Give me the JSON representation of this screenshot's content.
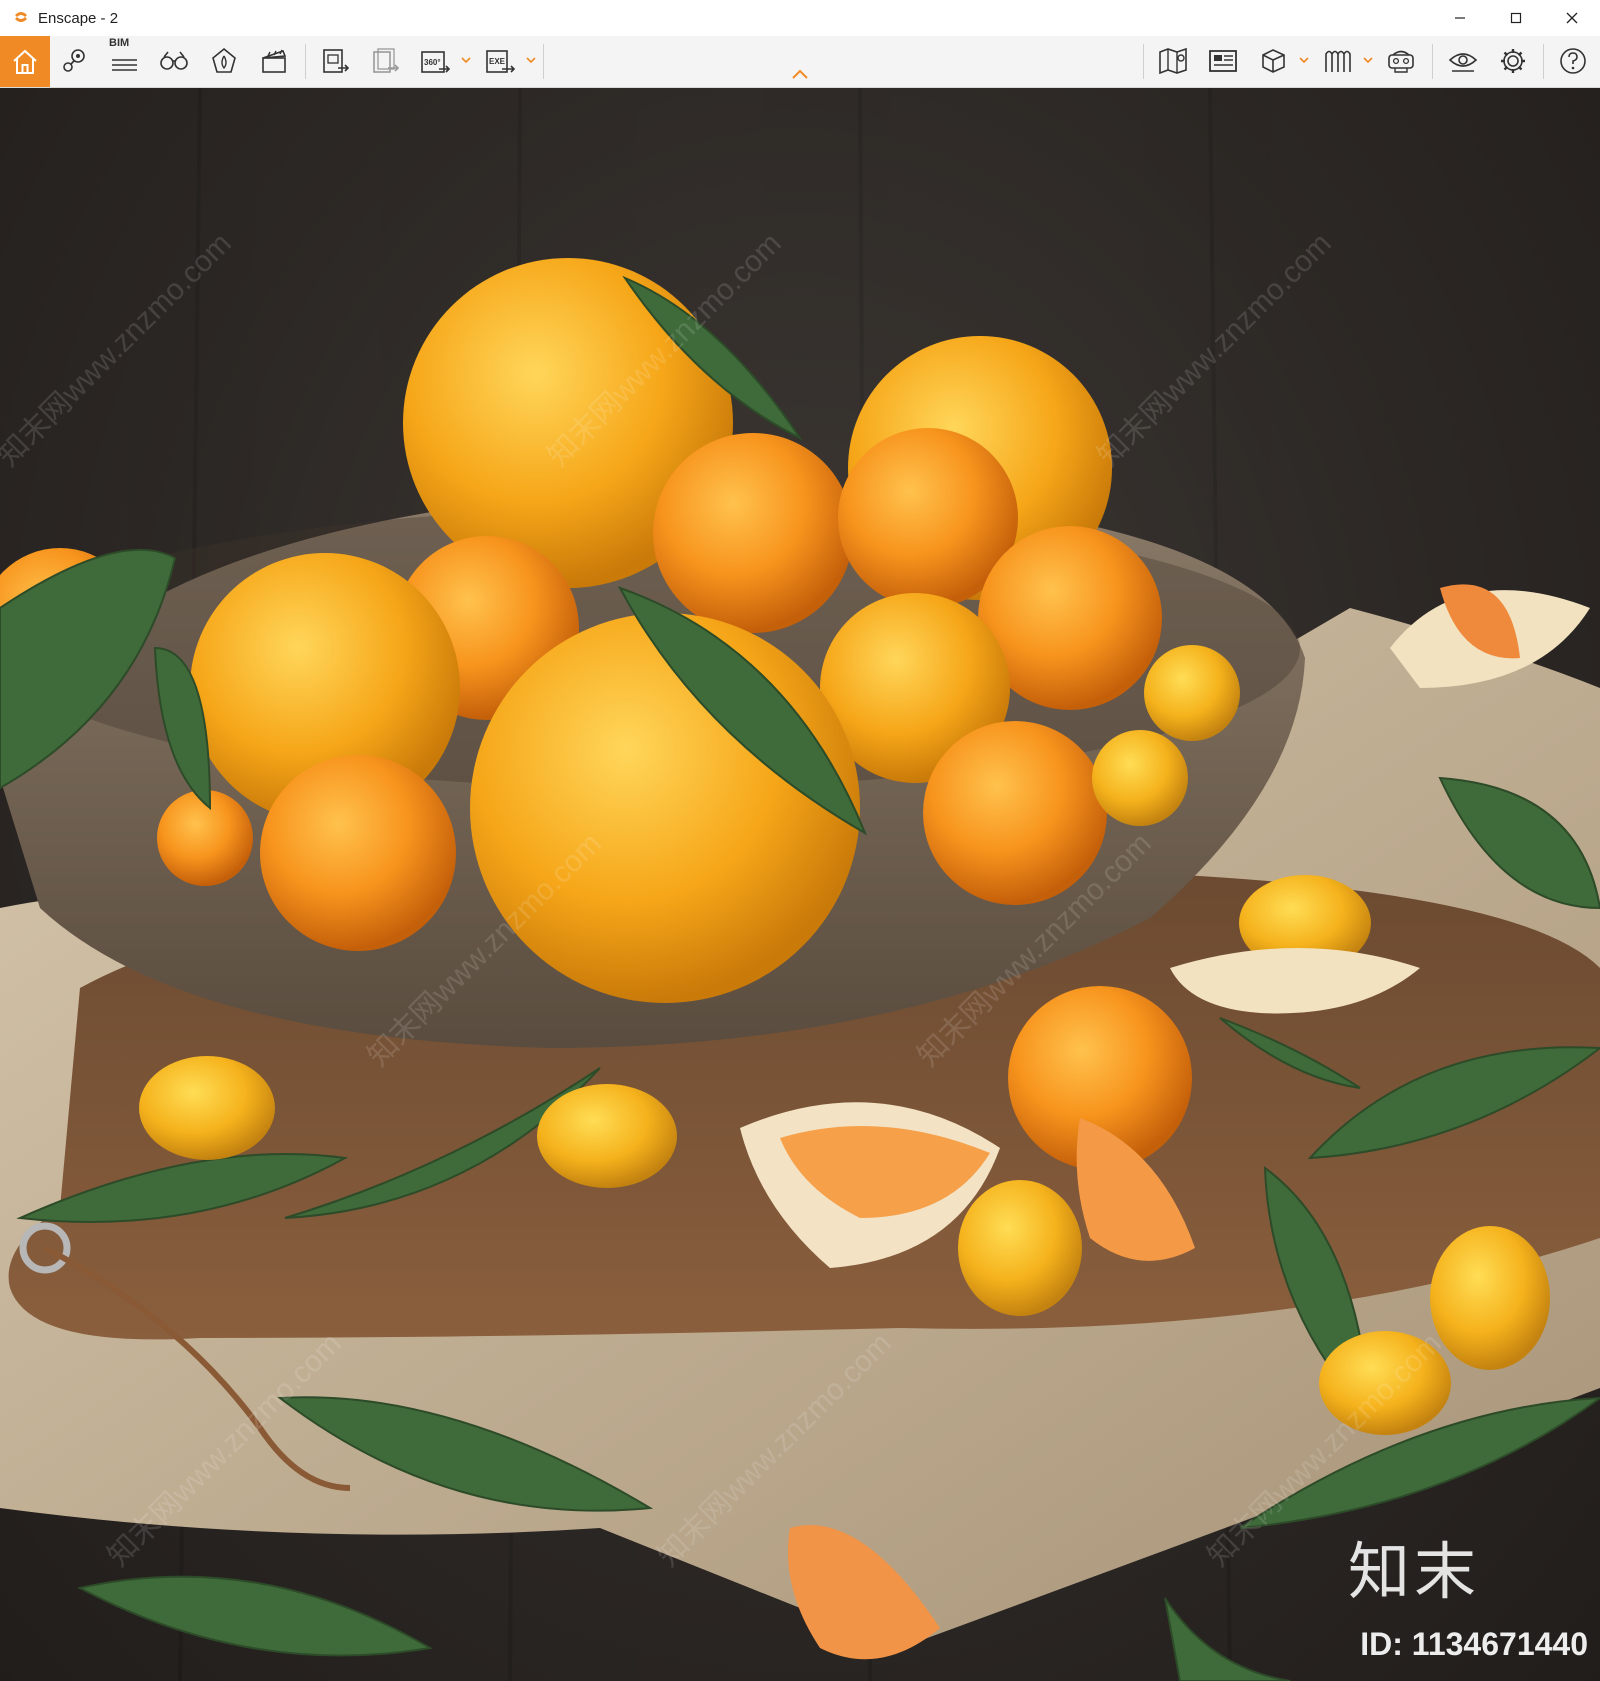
{
  "window": {
    "title": "Enscape - 2",
    "controls": [
      "minimize",
      "maximize",
      "close"
    ]
  },
  "toolbar": {
    "accent_color": "#f08a24",
    "left_tools": [
      {
        "name": "home",
        "icon": "home-icon",
        "active": true
      },
      {
        "name": "views",
        "icon": "map-pin-icon"
      },
      {
        "name": "bim",
        "icon": "bim-list-icon",
        "label": "BIM"
      },
      {
        "name": "binoculars",
        "icon": "binoculars-icon"
      },
      {
        "name": "atmosphere",
        "icon": "atmosphere-icon"
      },
      {
        "name": "video-editor",
        "icon": "clapperboard-icon"
      },
      {
        "name": "screenshot",
        "icon": "screenshot-export-icon"
      },
      {
        "name": "batch-render",
        "icon": "batch-render-icon"
      },
      {
        "name": "panorama",
        "icon": "panorama-360-icon",
        "label": "360°"
      },
      {
        "name": "exe-export",
        "icon": "exe-export-icon",
        "label": "EXE"
      }
    ],
    "right_tools": [
      {
        "name": "map",
        "icon": "map-icon"
      },
      {
        "name": "minimap",
        "icon": "minimap-icon"
      },
      {
        "name": "view-cube",
        "icon": "cube-icon"
      },
      {
        "name": "asset-library",
        "icon": "asset-library-icon"
      },
      {
        "name": "vr-headset",
        "icon": "vr-headset-icon"
      },
      {
        "name": "visual-settings",
        "icon": "eye-settings-icon"
      },
      {
        "name": "general-settings",
        "icon": "gear-icon"
      },
      {
        "name": "help",
        "icon": "help-icon"
      }
    ]
  },
  "viewport": {
    "watermark_text": "知末",
    "watermark_id": "ID: 1134671440",
    "repeated_watermark": "知末网www.znzmo.com"
  }
}
